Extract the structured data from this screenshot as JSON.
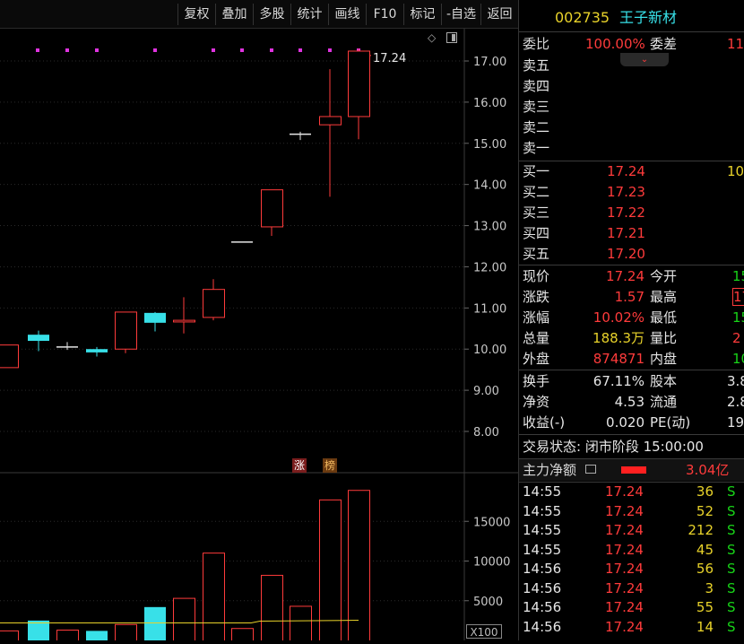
{
  "toolbar": {
    "buttons": [
      "复权",
      "叠加",
      "多股",
      "统计",
      "画线",
      "F10",
      "标记",
      "-自选",
      "返回"
    ]
  },
  "chart": {
    "last_price_label": "17.24",
    "y_ticks": [
      "17.00",
      "16.00",
      "15.00",
      "14.00",
      "13.00",
      "12.00",
      "11.00",
      "10.00",
      "9.00",
      "8.00"
    ],
    "vol_ticks": [
      "15000",
      "10000",
      "5000"
    ],
    "vol_unit": "X100",
    "badges": [
      "涨",
      "榜"
    ],
    "colors": {
      "up": "#ff3b3b",
      "down": "#38e0e8",
      "flat": "#e6e6e6",
      "ma": "#e8d22a",
      "marker": "#e033e0"
    }
  },
  "chart_data": {
    "type": "candlestick",
    "ylim": [
      7.5,
      17.8
    ],
    "candles": [
      {
        "open": 9.55,
        "close": 10.1,
        "high": 10.1,
        "low": 9.55,
        "dir": "up"
      },
      {
        "open": 10.35,
        "close": 10.2,
        "high": 10.45,
        "low": 9.95,
        "dir": "down"
      },
      {
        "open": 10.05,
        "close": 10.05,
        "high": 10.17,
        "low": 9.98,
        "dir": "flat"
      },
      {
        "open": 10.0,
        "close": 9.92,
        "high": 10.05,
        "low": 9.82,
        "dir": "down"
      },
      {
        "open": 10.0,
        "close": 10.9,
        "high": 10.9,
        "low": 9.9,
        "dir": "up"
      },
      {
        "open": 10.88,
        "close": 10.64,
        "high": 10.9,
        "low": 10.43,
        "dir": "down"
      },
      {
        "open": 10.66,
        "close": 10.7,
        "high": 11.26,
        "low": 10.38,
        "dir": "up"
      },
      {
        "open": 10.77,
        "close": 11.45,
        "high": 11.7,
        "low": 10.7,
        "dir": "up"
      },
      {
        "open": 12.6,
        "close": 12.6,
        "high": 12.6,
        "low": 12.6,
        "dir": "flat"
      },
      {
        "open": 12.97,
        "close": 13.87,
        "high": 13.87,
        "low": 12.75,
        "dir": "up"
      },
      {
        "open": 15.22,
        "close": 15.22,
        "high": 15.28,
        "low": 15.08,
        "dir": "flat"
      },
      {
        "open": 15.45,
        "close": 15.65,
        "high": 16.8,
        "low": 13.7,
        "dir": "up"
      },
      {
        "open": 15.65,
        "close": 17.24,
        "high": 17.3,
        "low": 15.1,
        "dir": "up"
      }
    ],
    "volume_ylim": [
      0,
      20000
    ],
    "volumes": [
      {
        "v": 1200,
        "dir": "up"
      },
      {
        "v": 2500,
        "dir": "down"
      },
      {
        "v": 1300,
        "dir": "up"
      },
      {
        "v": 1200,
        "dir": "down"
      },
      {
        "v": 2000,
        "dir": "up"
      },
      {
        "v": 4200,
        "dir": "down"
      },
      {
        "v": 5300,
        "dir": "up"
      },
      {
        "v": 11000,
        "dir": "up"
      },
      {
        "v": 1500,
        "dir": "up"
      },
      {
        "v": 8200,
        "dir": "up"
      },
      {
        "v": 4300,
        "dir": "up"
      },
      {
        "v": 17700,
        "dir": "up"
      },
      {
        "v": 18900,
        "dir": "up"
      }
    ],
    "volume_ma": 2200
  },
  "quote": {
    "code": "002735",
    "name": "王子新材",
    "weibi_label": "委比",
    "weibi_value": "100.00%",
    "weicha_label": "委差",
    "weicha_value": "11",
    "sell": [
      {
        "label": "卖五",
        "price": "",
        "vol": ""
      },
      {
        "label": "卖四",
        "price": "",
        "vol": ""
      },
      {
        "label": "卖三",
        "price": "",
        "vol": ""
      },
      {
        "label": "卖二",
        "price": "",
        "vol": ""
      },
      {
        "label": "卖一",
        "price": "",
        "vol": ""
      }
    ],
    "buy": [
      {
        "label": "买一",
        "price": "17.24",
        "vol": "10"
      },
      {
        "label": "买二",
        "price": "17.23",
        "vol": ""
      },
      {
        "label": "买三",
        "price": "17.22",
        "vol": ""
      },
      {
        "label": "买四",
        "price": "17.21",
        "vol": ""
      },
      {
        "label": "买五",
        "price": "17.20",
        "vol": ""
      }
    ],
    "stats": [
      {
        "l1": "现价",
        "v1": "17.24",
        "c1": "red",
        "l2": "今开",
        "v2": "15",
        "c2": "green"
      },
      {
        "l1": "涨跌",
        "v1": "1.57",
        "c1": "red",
        "l2": "最高",
        "v2": "17",
        "c2": "red"
      },
      {
        "l1": "涨幅",
        "v1": "10.02%",
        "c1": "red",
        "l2": "最低",
        "v2": "15",
        "c2": "green"
      },
      {
        "l1": "总量",
        "v1": "188.3万",
        "c1": "yellow",
        "l2": "量比",
        "v2": "2",
        "c2": "red"
      },
      {
        "l1": "外盘",
        "v1": "874871",
        "c1": "red",
        "l2": "内盘",
        "v2": "100",
        "c2": "green"
      }
    ],
    "stats2": [
      {
        "l1": "换手",
        "v1": "67.11%",
        "l2": "股本",
        "v2": "3.8"
      },
      {
        "l1": "净资",
        "v1": "4.53",
        "l2": "流通",
        "v2": "2.8"
      },
      {
        "l1": "收益(-)",
        "v1": "0.020",
        "l2": "PE(动)",
        "v2": "19"
      }
    ],
    "status": "交易状态: 闭市阶段 15:00:00",
    "netflow_label": "主力净额",
    "netflow_value": "3.04亿",
    "ticks": [
      {
        "time": "14:55",
        "price": "17.24",
        "vol": "36",
        "side": "S"
      },
      {
        "time": "14:55",
        "price": "17.24",
        "vol": "52",
        "side": "S"
      },
      {
        "time": "14:55",
        "price": "17.24",
        "vol": "212",
        "side": "S"
      },
      {
        "time": "14:55",
        "price": "17.24",
        "vol": "45",
        "side": "S"
      },
      {
        "time": "14:56",
        "price": "17.24",
        "vol": "56",
        "side": "S"
      },
      {
        "time": "14:56",
        "price": "17.24",
        "vol": "3",
        "side": "S"
      },
      {
        "time": "14:56",
        "price": "17.24",
        "vol": "55",
        "side": "S"
      },
      {
        "time": "14:56",
        "price": "17.24",
        "vol": "14",
        "side": "S"
      }
    ]
  }
}
